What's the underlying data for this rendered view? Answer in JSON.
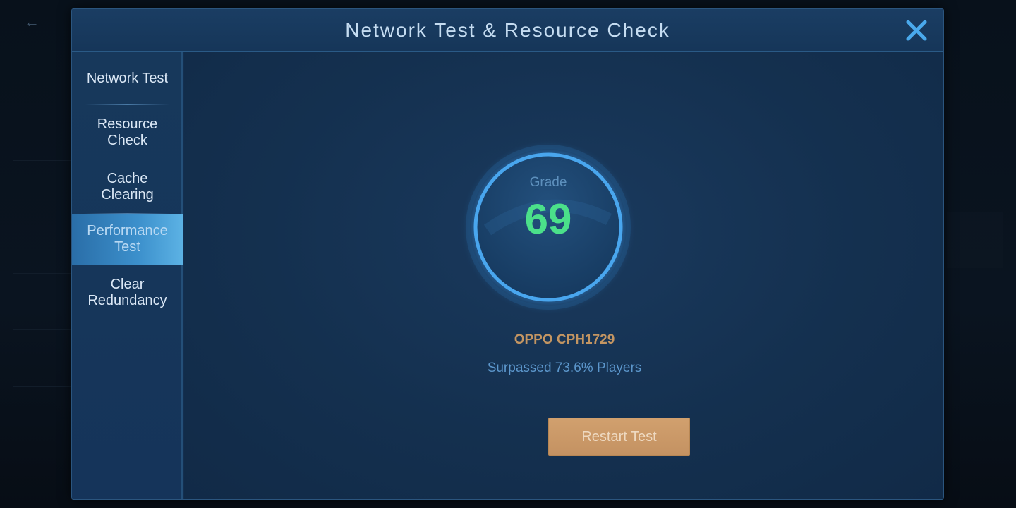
{
  "dialog": {
    "title": "Network Test & Resource Check",
    "close_icon": "close-icon"
  },
  "sidebar": {
    "items": [
      {
        "label": "Network Test",
        "active": false
      },
      {
        "label": "Resource\nCheck",
        "active": false
      },
      {
        "label": "Cache\nClearing",
        "active": false
      },
      {
        "label": "Performance\nTest",
        "active": true
      },
      {
        "label": "Clear\nRedundancy",
        "active": false
      }
    ]
  },
  "result": {
    "grade_label": "Grade",
    "grade_value": "69",
    "device": "OPPO CPH1729",
    "surpassed": "Surpassed 73.6% Players",
    "restart_label": "Restart Test"
  },
  "colors": {
    "accent_green": "#4be08a",
    "button_gold": "#c9976a",
    "dialog_bg": "#132f50",
    "active_tab": "#3c90cc"
  }
}
